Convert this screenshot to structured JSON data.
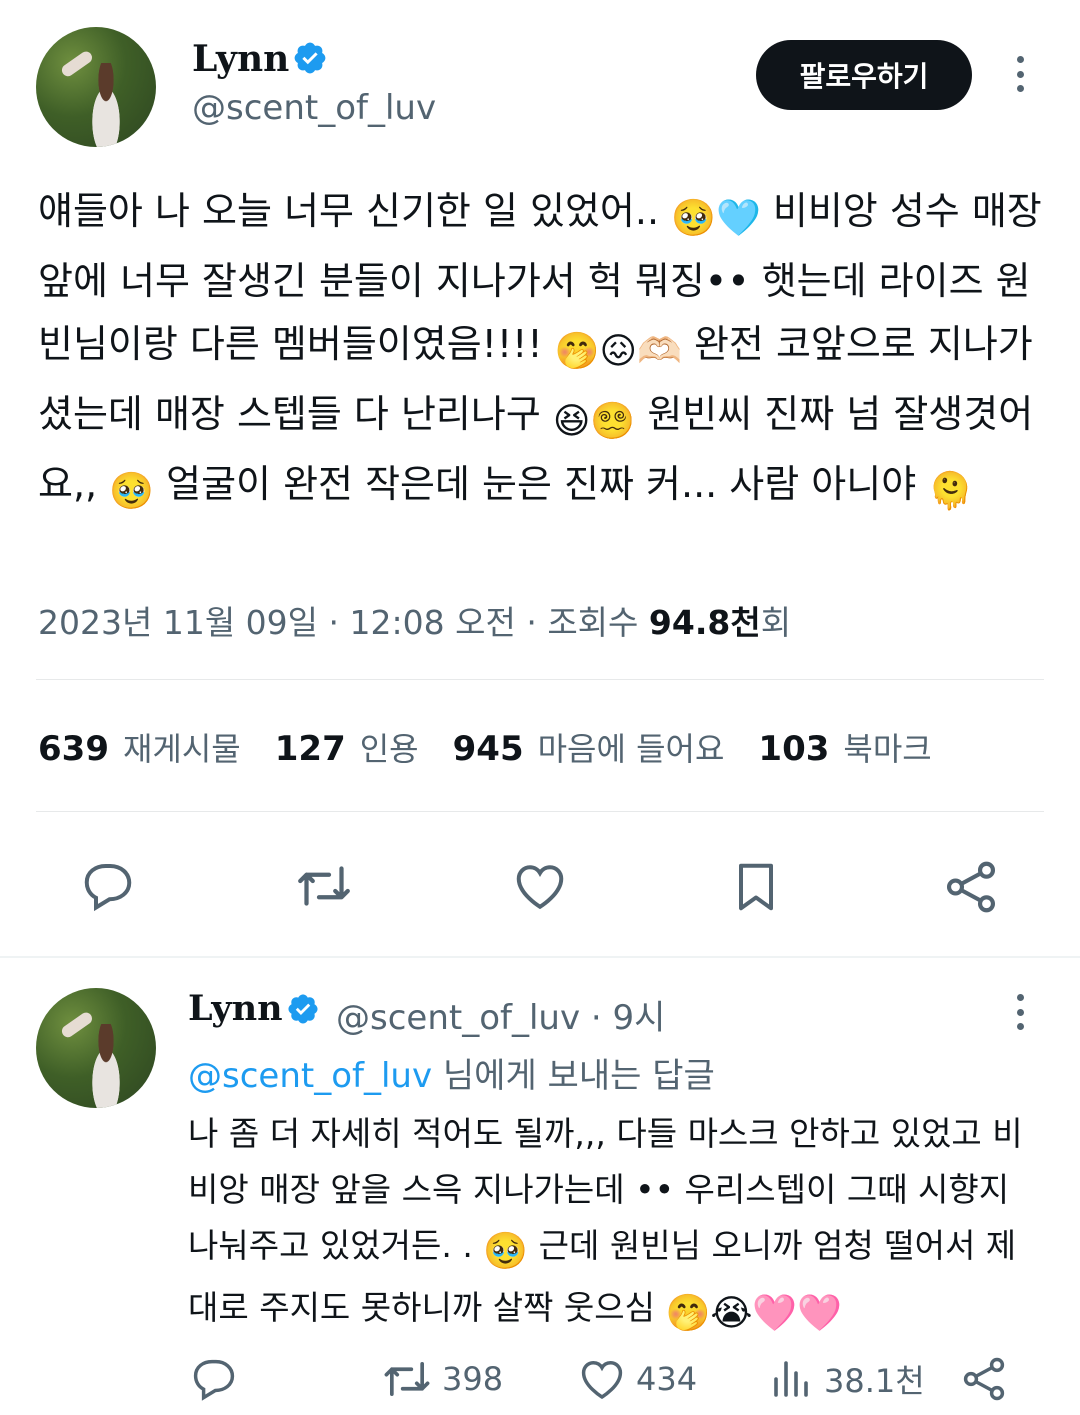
{
  "main_tweet": {
    "author_name": "Lynn",
    "handle": "@scent_of_luv",
    "follow_label": "팔로우하기",
    "text_parts": [
      "얘들아 나 오늘 너무 신기한 일 있었어.. ",
      "🥹🩵",
      " 비비앙 성수 매장 앞에 너무 잘생긴 분들이 지나가서 헉 뭐징•• 햇는데 라이즈 원빈님이랑 다른 멤버들이였음!!!! ",
      "🤭😖🫶🏻",
      " 완전 코앞으로 지나가셨는데 매장 스텝들 다 난리나구 ",
      "😆😵‍💫",
      " 원빈씨 진짜 넘 잘생겻어요,, ",
      "🥹",
      " 얼굴이 완전 작은데 눈은 진짜 커... 사람 아니야 ",
      "🫠"
    ],
    "date": "2023년 11월 09일",
    "time": "12:08 오전",
    "views_label": "조회수",
    "views_value": "94.8천",
    "views_suffix": "회",
    "stats": [
      {
        "value": "639",
        "label": "재게시물"
      },
      {
        "value": "127",
        "label": "인용"
      },
      {
        "value": "945",
        "label": "마음에 들어요"
      },
      {
        "value": "103",
        "label": "북마크"
      }
    ],
    "icons": [
      "reply-icon",
      "retweet-icon",
      "like-icon",
      "bookmark-icon",
      "share-icon"
    ]
  },
  "reply_tweet": {
    "author_name": "Lynn",
    "handle": "@scent_of_luv",
    "separator": "·",
    "time_ago": "9시",
    "reply_to_mention": "@scent_of_luv",
    "reply_to_suffix": " 님에게 보내는 답글",
    "text_parts": [
      "나 좀 더 자세히 적어도 될까,,, 다들 마스크 안하고 있었고 비비앙 매장 앞을 스윽 지나가는데 •• 우리스텝이 그때 시향지 나눠주고 있었거든. . ",
      "🥹",
      " 근데 원빈님 오니까 엄청 떨어서 제대로 주지도 못하니까 살짝 웃으심 ",
      "🤭😭🩷🩷"
    ],
    "counts": {
      "retweets": "398",
      "likes": "434",
      "views": "38.1천"
    }
  },
  "colors": {
    "text": "#0f1419",
    "secondary": "#536471",
    "accent": "#1d9bf0",
    "divider": "#e7e9ea"
  }
}
